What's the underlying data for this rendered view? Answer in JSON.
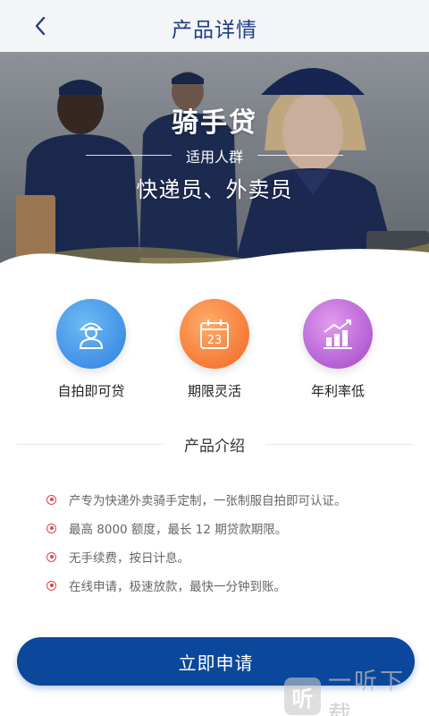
{
  "nav": {
    "title": "产品详情",
    "back_icon": "chevron-left-icon"
  },
  "hero": {
    "title": "骑手贷",
    "subtitle": "适用人群",
    "target": "快递员、外卖员"
  },
  "features": [
    {
      "label": "自拍即可贷",
      "icon": "person-icon",
      "color_from": "#5db0f2",
      "color_to": "#2f7fe0"
    },
    {
      "label": "期限灵活",
      "icon": "calendar-icon",
      "calendar_number": "23",
      "color_from": "#ff9a52",
      "color_to": "#f26622"
    },
    {
      "label": "年利率低",
      "icon": "bar-chart-icon",
      "color_from": "#d68ae6",
      "color_to": "#a146c8"
    }
  ],
  "intro": {
    "title": "产品介绍",
    "points": [
      "产专为快递外卖骑手定制，一张制服自拍即可认证。",
      "最高 8000 额度，最长 12 期贷款期限。",
      "无手续费，按日计息。",
      "在线申请，极速放款，最快一分钟到账。"
    ]
  },
  "apply_button": {
    "label": "立即申请"
  },
  "watermark": {
    "icon_char": "听",
    "text": "一听下载"
  },
  "colors": {
    "brand": "#0b479b",
    "bullet": "#d94848",
    "nav_title": "#1d3f86"
  }
}
